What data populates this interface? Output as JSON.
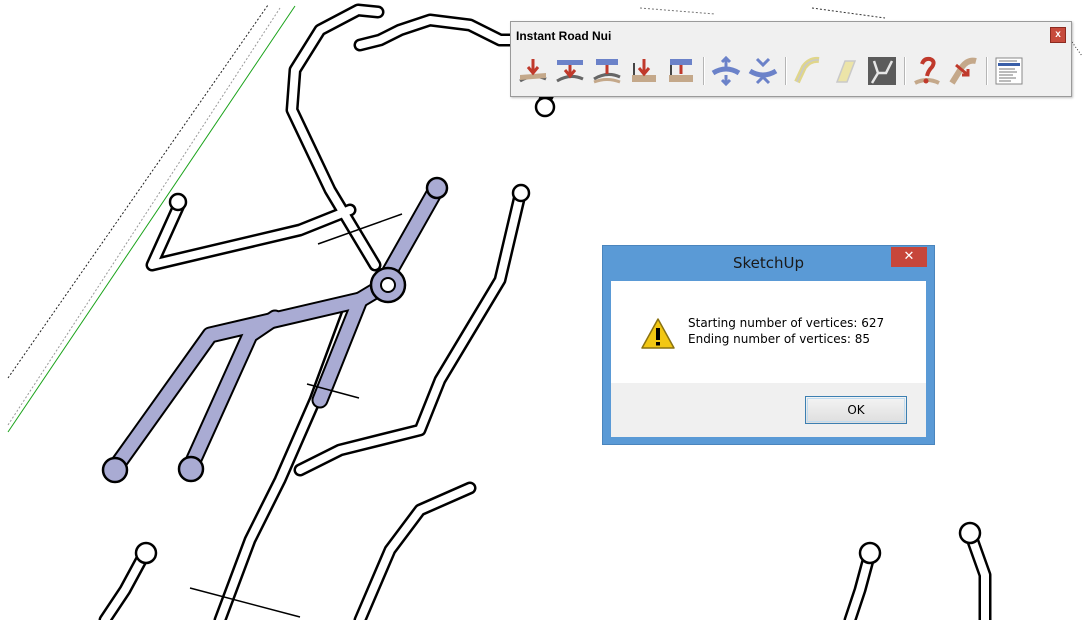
{
  "toolbar": {
    "title": "Instant Road Nui",
    "close_label": "x",
    "buttons": [
      {
        "icon": "road-from-contours-icon"
      },
      {
        "icon": "road-from-centerline-icon"
      },
      {
        "icon": "road-from-edges-icon"
      },
      {
        "icon": "road-drape-icon"
      },
      {
        "icon": "road-stamp-icon"
      },
      {
        "icon": "raise-road-icon"
      },
      {
        "icon": "lower-road-icon"
      },
      {
        "icon": "road-curve-disabled-icon"
      },
      {
        "icon": "road-offset-disabled-icon"
      },
      {
        "icon": "road-network-icon"
      },
      {
        "icon": "help-icon"
      },
      {
        "icon": "road-tool-icon"
      },
      {
        "icon": "options-list-icon"
      }
    ]
  },
  "dialog": {
    "title": "SketchUp",
    "close_label": "✕",
    "message_line1": "Starting number of vertices: 627",
    "message_line2": "Ending number of vertices: 85",
    "ok_label": "OK",
    "icon": "warning-icon"
  },
  "colors": {
    "road_fill": "#a9abd3",
    "road_outline": "#000000",
    "dialog_frame": "#5a9ad6",
    "dialog_close": "#c7463a",
    "terrain_edge": "#1aa31a"
  }
}
